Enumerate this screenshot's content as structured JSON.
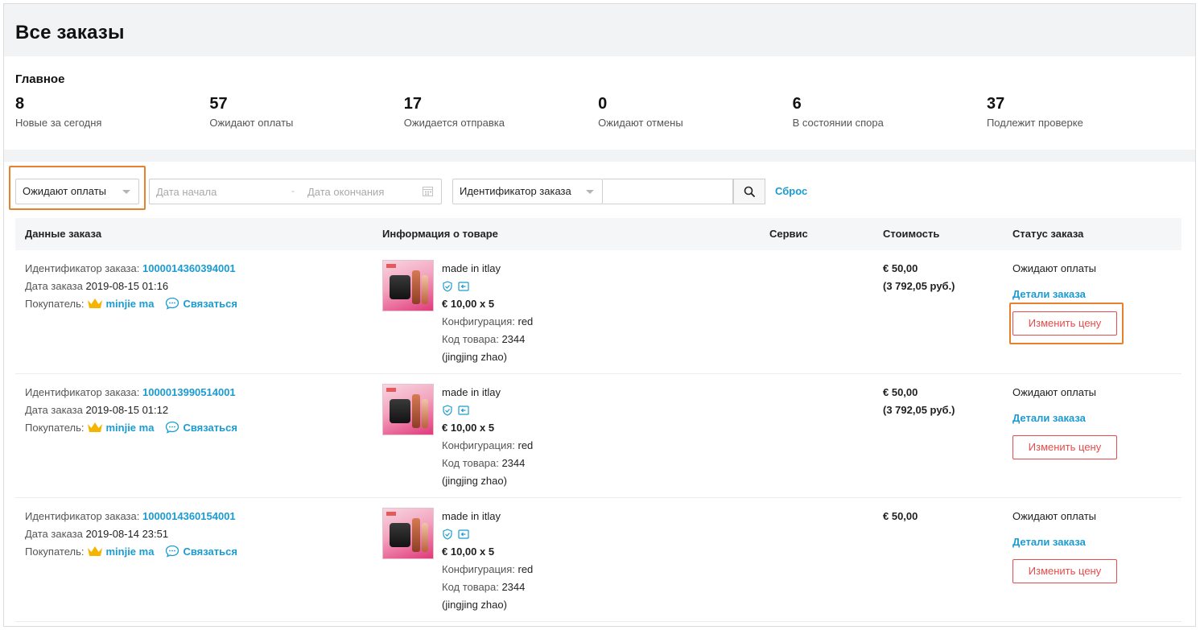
{
  "page": {
    "title": "Все заказы"
  },
  "summary": {
    "title": "Главное",
    "stats": [
      {
        "value": "8",
        "label": "Новые за сегодня"
      },
      {
        "value": "57",
        "label": "Ожидают оплаты"
      },
      {
        "value": "17",
        "label": "Ожидается отправка"
      },
      {
        "value": "0",
        "label": "Ожидают отмены"
      },
      {
        "value": "6",
        "label": "В состоянии спора"
      },
      {
        "value": "37",
        "label": "Подлежит проверке"
      }
    ]
  },
  "filters": {
    "status_select": "Ожидают оплаты",
    "date_start_placeholder": "Дата начала",
    "date_separator": "-",
    "date_end_placeholder": "Дата окончания",
    "search_type_select": "Идентификатор заказа",
    "search_value": "",
    "reset_label": "Сброс"
  },
  "table": {
    "headers": {
      "order": "Данные заказа",
      "product": "Информация о товаре",
      "service": "Сервис",
      "cost": "Стоимость",
      "status": "Статус заказа"
    },
    "rows": [
      {
        "order_id_label": "Идентификатор заказа:",
        "order_id": "1000014360394001",
        "date_label": "Дата заказа",
        "date": "2019-08-15 01:16",
        "buyer_label": "Покупатель:",
        "buyer": "minjie ma",
        "contact": "Связаться",
        "product_name": "made in itlay",
        "unit_price": "€ 10,00 x 5",
        "config_label": "Конфигурация:",
        "config": "red",
        "sku_label": "Код товара:",
        "sku": "2344",
        "seller": "(jingjing zhao)",
        "cost": "€ 50,00",
        "cost_rub": "(3 792,05 руб.)",
        "status": "Ожидают оплаты",
        "details": "Детали заказа",
        "change_price": "Изменить цену"
      },
      {
        "order_id_label": "Идентификатор заказа:",
        "order_id": "1000013990514001",
        "date_label": "Дата заказа",
        "date": "2019-08-15 01:12",
        "buyer_label": "Покупатель:",
        "buyer": "minjie ma",
        "contact": "Связаться",
        "product_name": "made in itlay",
        "unit_price": "€ 10,00 x 5",
        "config_label": "Конфигурация:",
        "config": "red",
        "sku_label": "Код товара:",
        "sku": "2344",
        "seller": "(jingjing zhao)",
        "cost": "€ 50,00",
        "cost_rub": "(3 792,05 руб.)",
        "status": "Ожидают оплаты",
        "details": "Детали заказа",
        "change_price": "Изменить цену"
      },
      {
        "order_id_label": "Идентификатор заказа:",
        "order_id": "1000014360154001",
        "date_label": "Дата заказа",
        "date": "2019-08-14 23:51",
        "buyer_label": "Покупатель:",
        "buyer": "minjie ma",
        "contact": "Связаться",
        "product_name": "made in itlay",
        "unit_price": "€ 10,00 x 5",
        "config_label": "Конфигурация:",
        "config": "red",
        "sku_label": "Код товара:",
        "sku": "2344",
        "seller": "(jingjing zhao)",
        "cost": "€ 50,00",
        "status": "Ожидают оплаты",
        "details": "Детали заказа",
        "change_price": "Изменить цену"
      }
    ]
  },
  "colors": {
    "link": "#1a9bd1",
    "highlight": "#e8812c",
    "danger": "#e84b4b",
    "crown": "#f5b400"
  },
  "icons": [
    "caret-down-icon",
    "calendar-icon",
    "search-icon",
    "crown-icon",
    "chat-icon",
    "shield-check-icon",
    "return-icon"
  ]
}
